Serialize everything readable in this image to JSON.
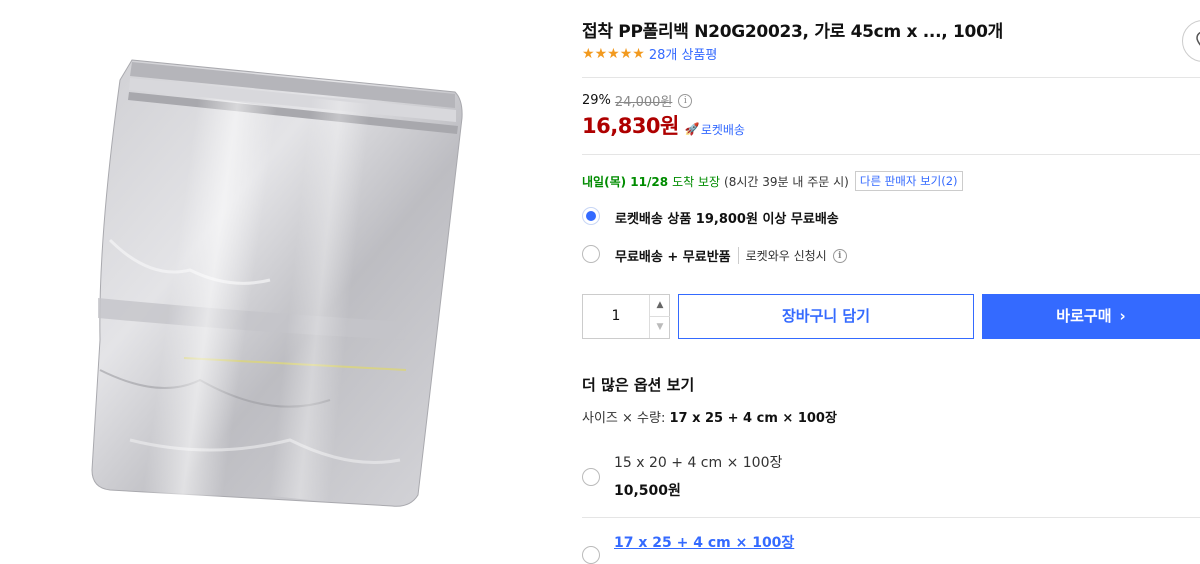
{
  "product": {
    "title": "접착 PP폴리백 N20G20023, 가로 45cm x ..., 100개",
    "rating_stars": 5,
    "review_count_label": "28개 상품평"
  },
  "price": {
    "discount_rate": "29%",
    "original_price": "24,000원",
    "sale_price": "16,830원",
    "rocket_label": "로켓배송"
  },
  "delivery": {
    "date": "내일(목) 11/28",
    "guarantee": "도착 보장",
    "note": "(8시간 39분 내 주문 시)",
    "other_sellers": "다른 판매자 보기(2)"
  },
  "shipping_options": [
    {
      "label": "로켓배송 상품 19,800원 이상 무료배송",
      "selected": true
    },
    {
      "label": "무료배송 + 무료반품",
      "sub": "로켓와우 신청시",
      "selected": false
    }
  ],
  "purchase": {
    "quantity": "1",
    "cart_label": "장바구니 담기",
    "buy_label": "바로구매"
  },
  "options": {
    "heading": "더 많은 옵션 보기",
    "selected_prefix": "사이즈 × 수량: ",
    "selected_value": "17 x 25 + 4 cm × 100장",
    "items": [
      {
        "name": "15 x 20 + 4 cm × 100장",
        "price": "10,500원",
        "selected": false
      },
      {
        "name": "17 x 25 + 4 cm × 100장",
        "selected": true
      }
    ]
  },
  "colors": {
    "accent": "#346aff",
    "price_red": "#ae0000",
    "delivery_green": "#008c00",
    "star_orange": "#f29a1f"
  }
}
